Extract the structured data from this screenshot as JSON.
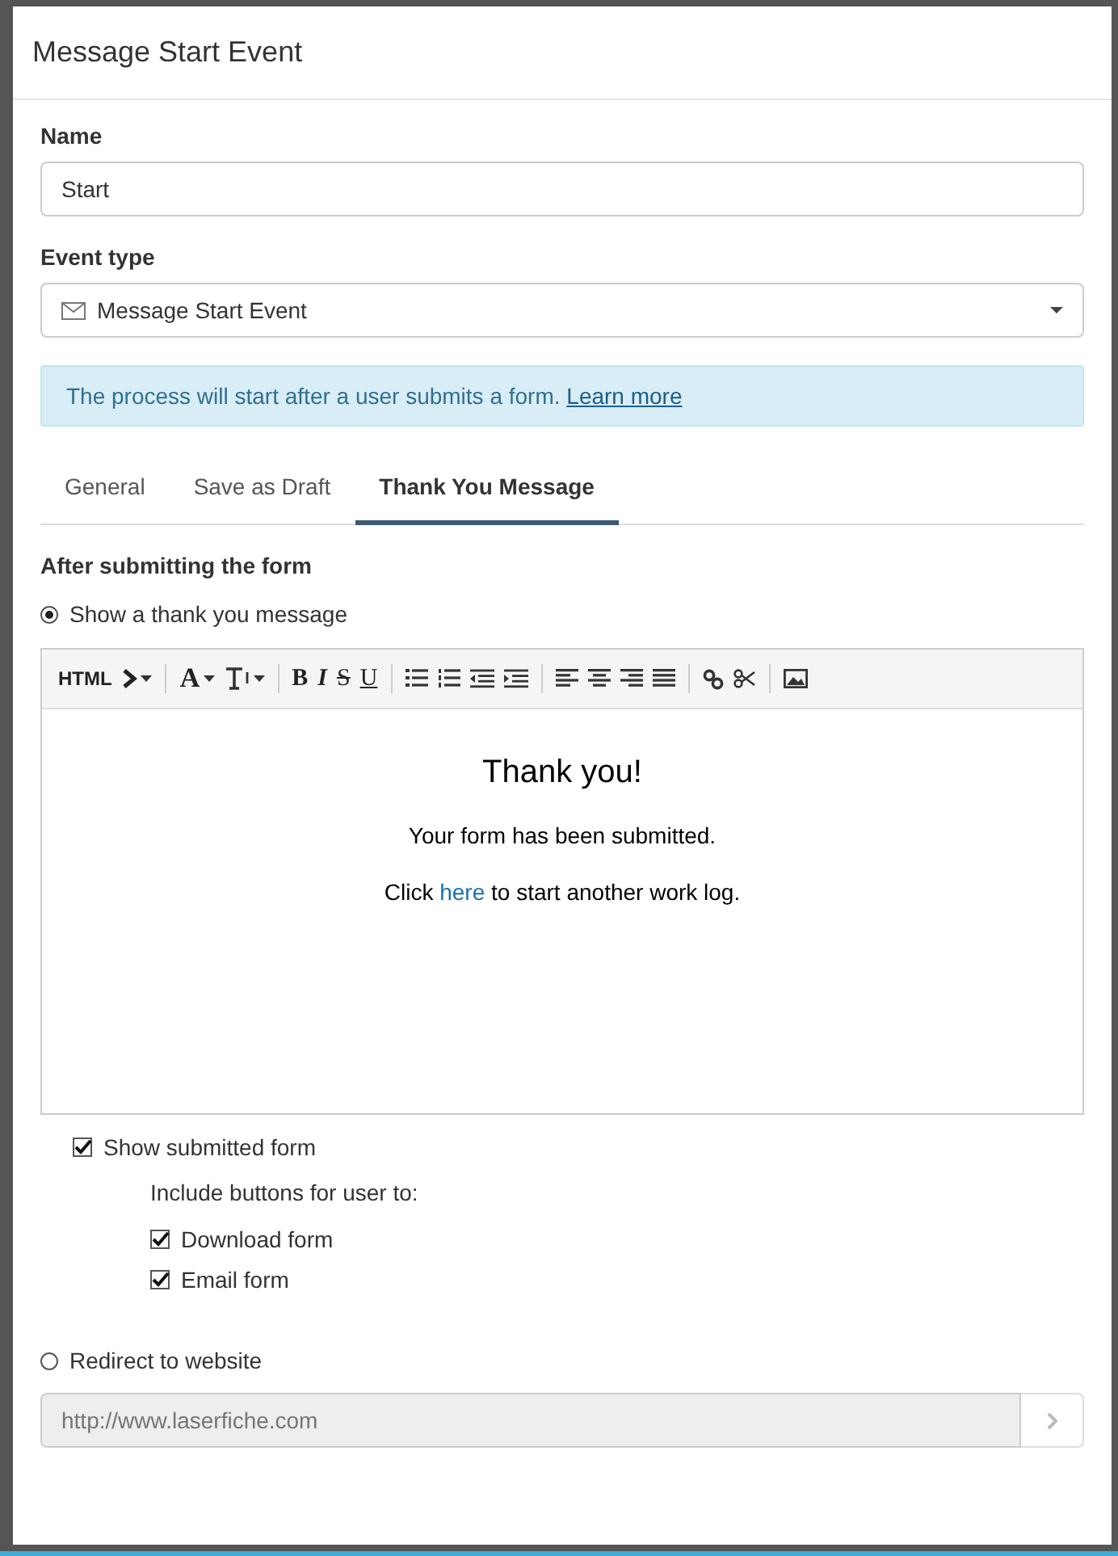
{
  "window": {
    "title": "Message Start Event"
  },
  "name_field": {
    "label": "Name",
    "value": "Start"
  },
  "event_type": {
    "label": "Event type",
    "value": "Message Start Event"
  },
  "info": {
    "text": "The process will start after a user submits a form.",
    "link": "Learn more"
  },
  "tabs": [
    {
      "label": "General",
      "selected": false
    },
    {
      "label": "Save as Draft",
      "selected": false
    },
    {
      "label": "Thank You Message",
      "selected": true
    }
  ],
  "section_title": "After submitting the form",
  "thank_you_option": {
    "label": "Show a thank you message",
    "selected": true
  },
  "toolbar": {
    "source_label": "HTML",
    "font_label": "A",
    "format_labels": [
      "B",
      "I",
      "S",
      "U"
    ]
  },
  "editor": {
    "heading": "Thank you!",
    "line": "Your form has been submitted.",
    "click_before": "Click",
    "click_link": "here",
    "click_after": "to start another work log."
  },
  "show_submitted": {
    "label": "Show submitted form",
    "checked": true
  },
  "include_label": "Include buttons for user to:",
  "include_options": [
    {
      "label": "Download form",
      "checked": true
    },
    {
      "label": "Email form",
      "checked": true
    }
  ],
  "redirect_option": {
    "label": "Redirect to website",
    "selected": false
  },
  "url_field": {
    "placeholder": "http://www.laserfiche.com",
    "disabled": true
  }
}
